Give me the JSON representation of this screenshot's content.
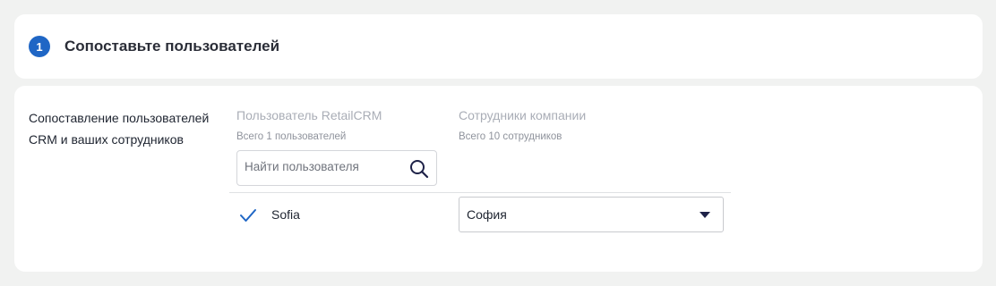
{
  "step": {
    "number": "1",
    "title": "Сопоставьте пользователей"
  },
  "mapping": {
    "description_line1": "Сопоставление пользователей",
    "description_line2": "CRM и ваших сотрудников",
    "crm_column": {
      "title": "Пользователь RetailCRM",
      "count": "Всего 1 пользователей"
    },
    "staff_column": {
      "title": "Сотрудники компании",
      "count": "Всего 10 сотрудников"
    },
    "search": {
      "placeholder": "Найти пользователя",
      "icon": "search-icon"
    },
    "rows": [
      {
        "user": "Sofia",
        "mapped": true,
        "selected_employee": "София"
      }
    ]
  },
  "colors": {
    "accent": "#1f66c5",
    "page_bg": "#f1f2f1",
    "card_bg": "#ffffff"
  }
}
